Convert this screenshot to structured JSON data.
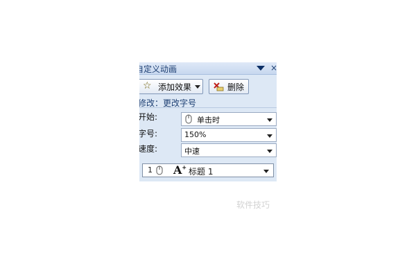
{
  "pane": {
    "title": "自定义动画",
    "add_effect_label": "添加效果",
    "remove_label": "删除",
    "modify_label": "修改：更改字号",
    "start_label": "开始:",
    "start_value": "单击时",
    "size_label": "字号:",
    "size_value": "150%",
    "speed_label": "速度:",
    "speed_value": "中速",
    "list_item_number": "1",
    "list_item_label": "标题 1"
  },
  "icons": [
    "star-icon",
    "remove-icon",
    "mouse-icon",
    "font-effect-icon",
    "chevron-down-icon",
    "close-icon"
  ],
  "watermark": "软件技巧"
}
